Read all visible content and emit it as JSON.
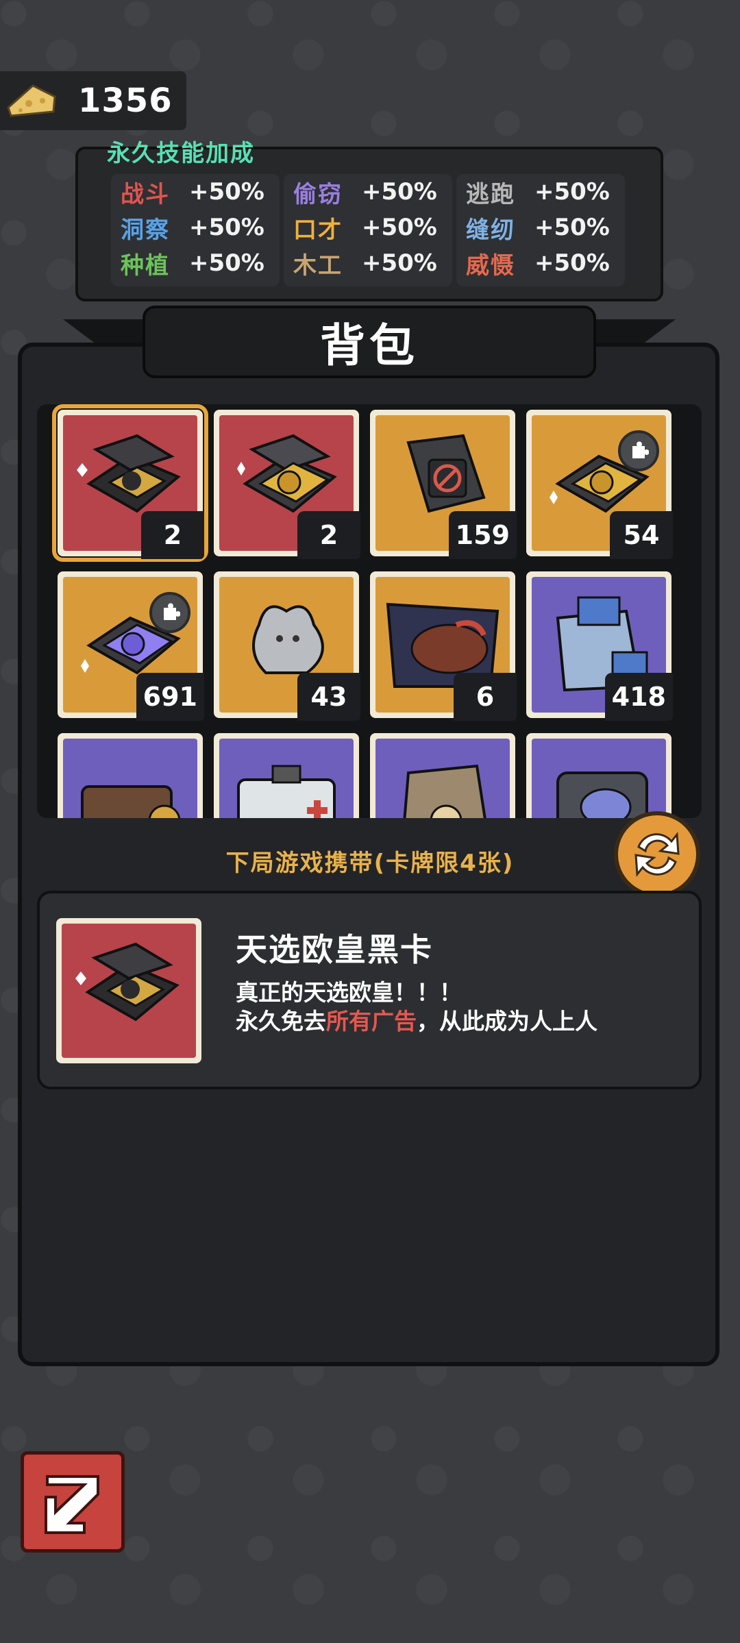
{
  "currency": {
    "icon": "cheese-icon",
    "value": "1356"
  },
  "skills": {
    "title": "永久技能加成",
    "columns": [
      [
        {
          "name": "战斗",
          "value": "+50%",
          "color": "#e0544f"
        },
        {
          "name": "洞察",
          "value": "+50%",
          "color": "#5aa3e6"
        },
        {
          "name": "种植",
          "value": "+50%",
          "color": "#6cc35b"
        }
      ],
      [
        {
          "name": "偷窃",
          "value": "+50%",
          "color": "#9a7fe0"
        },
        {
          "name": "口才",
          "value": "+50%",
          "color": "#f0b13b"
        },
        {
          "name": "木工",
          "value": "+50%",
          "color": "#c9a572"
        }
      ],
      [
        {
          "name": "逃跑",
          "value": "+50%",
          "color": "#b8b8b8"
        },
        {
          "name": "缝纫",
          "value": "+50%",
          "color": "#7fb2e6"
        },
        {
          "name": "威慑",
          "value": "+50%",
          "color": "#e36a4f"
        }
      ]
    ]
  },
  "bag": {
    "title": "背包",
    "items": [
      {
        "count": "2",
        "bg": "red",
        "icon": "black-card-box-icon",
        "selected": true
      },
      {
        "count": "2",
        "bg": "red",
        "icon": "gold-card-box-icon"
      },
      {
        "count": "159",
        "bg": "gold",
        "icon": "no-ads-pack-icon"
      },
      {
        "count": "54",
        "bg": "gold",
        "icon": "gold-card-fragment-icon",
        "puzzle": true
      },
      {
        "count": "691",
        "bg": "gold",
        "icon": "purple-card-fragment-icon",
        "puzzle": true
      },
      {
        "count": "43",
        "bg": "gold",
        "icon": "mouse-statue-icon"
      },
      {
        "count": "6",
        "bg": "gold",
        "icon": "steak-menu-icon"
      },
      {
        "count": "418",
        "bg": "purple",
        "icon": "shopping-bag-icon"
      },
      {
        "count": "",
        "bg": "purple",
        "icon": "wallet-icon"
      },
      {
        "count": "",
        "bg": "purple",
        "icon": "first-aid-kit-icon"
      },
      {
        "count": "",
        "bg": "purple",
        "icon": "paper-bag-icon"
      },
      {
        "count": "",
        "bg": "purple",
        "icon": "supply-case-icon"
      }
    ]
  },
  "carry_label": "下局游戏携带(卡牌限4张)",
  "detail": {
    "name": "天选欧皇黑卡",
    "line1": "真正的天选欧皇！！！",
    "line2_prefix": "永久免去",
    "line2_highlight": "所有广告",
    "line2_suffix": "，从此成为人上人"
  },
  "colors": {
    "accent": "#e49a3a",
    "highlight": "#e5574f",
    "skill_title": "#58e0b2"
  }
}
